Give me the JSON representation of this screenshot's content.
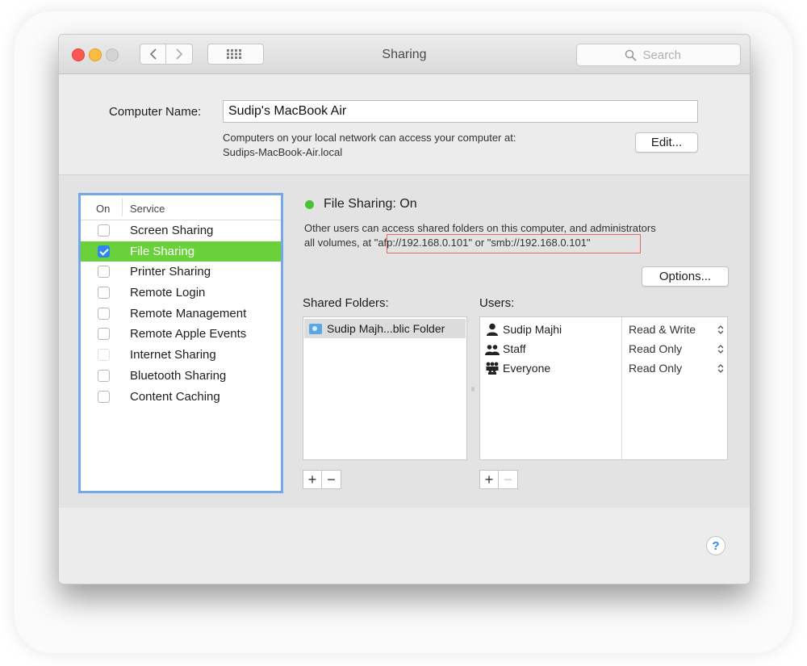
{
  "window": {
    "title": "Sharing",
    "search_placeholder": "Search"
  },
  "computer_name": {
    "label": "Computer Name:",
    "value": "Sudip's MacBook Air",
    "description_line1": "Computers on your local network can access your computer at:",
    "description_line2": "Sudips-MacBook-Air.local",
    "edit_label": "Edit..."
  },
  "services": {
    "header_on": "On",
    "header_service": "Service",
    "items": [
      {
        "name": "Screen Sharing",
        "checked": false
      },
      {
        "name": "File Sharing",
        "checked": true,
        "selected": true
      },
      {
        "name": "Printer Sharing",
        "checked": false
      },
      {
        "name": "Remote Login",
        "checked": false
      },
      {
        "name": "Remote Management",
        "checked": false
      },
      {
        "name": "Remote Apple Events",
        "checked": false
      },
      {
        "name": "Internet Sharing",
        "checked": false
      },
      {
        "name": "Bluetooth Sharing",
        "checked": false
      },
      {
        "name": "Content Caching",
        "checked": false
      }
    ]
  },
  "status": {
    "label": "File Sharing: On",
    "desc_line1": "Other users can access shared folders on this computer, and administrators",
    "desc_line2_prefix": "all volumes, at ",
    "address": "\"afp://192.168.0.101\" or \"smb://192.168.0.101\"",
    "options_label": "Options...",
    "dot_color": "#47c431"
  },
  "shared_folders": {
    "label": "Shared Folders:",
    "items": [
      "Sudip Majh...blic Folder"
    ]
  },
  "users": {
    "label": "Users:",
    "items": [
      {
        "name": "Sudip Majhi",
        "permission": "Read & Write"
      },
      {
        "name": "Staff",
        "permission": "Read Only"
      },
      {
        "name": "Everyone",
        "permission": "Read Only"
      }
    ]
  },
  "controls": {
    "add": "+",
    "remove": "−",
    "help": "?"
  },
  "colors": {
    "selection_green": "#6ad13c",
    "focus_ring": "#76a8e6",
    "checkbox_blue": "#2f86f0",
    "highlight_box": "#e06b6b"
  }
}
